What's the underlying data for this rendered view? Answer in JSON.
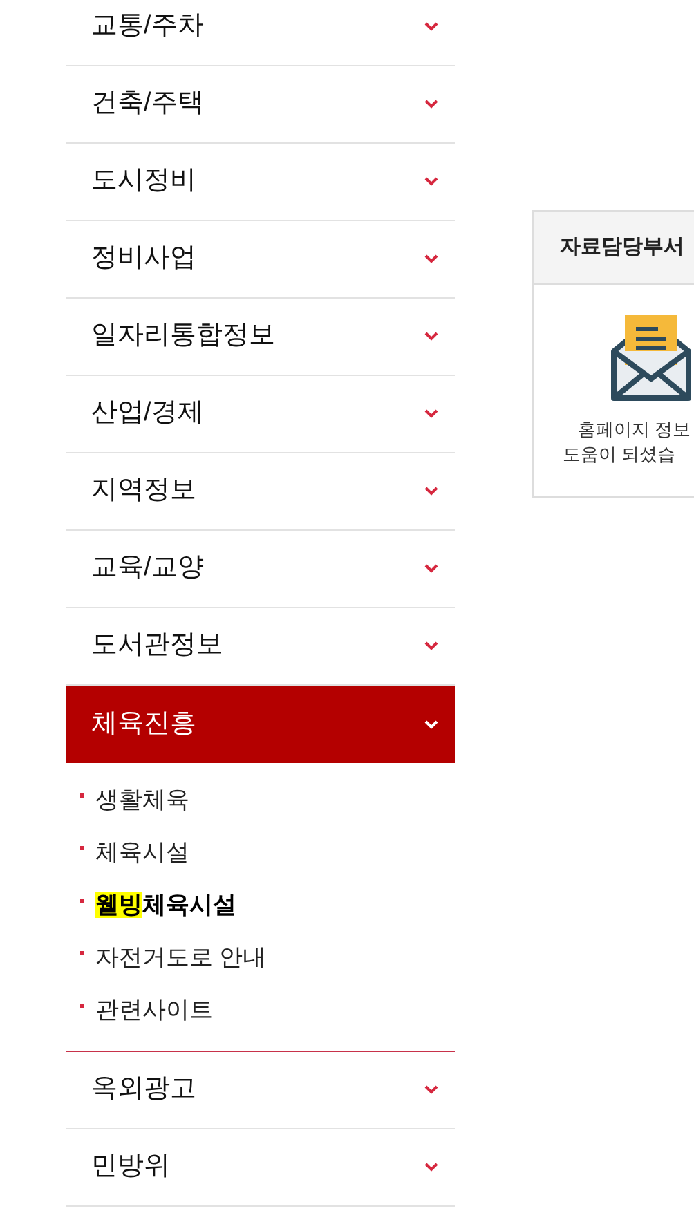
{
  "menu": [
    {
      "label": "교통/주차",
      "expanded": false
    },
    {
      "label": "건축/주택",
      "expanded": false
    },
    {
      "label": "도시정비",
      "expanded": false
    },
    {
      "label": "정비사업",
      "expanded": false
    },
    {
      "label": "일자리통합정보",
      "expanded": false
    },
    {
      "label": "산업/경제",
      "expanded": false
    },
    {
      "label": "지역정보",
      "expanded": false
    },
    {
      "label": "교육/교양",
      "expanded": false
    },
    {
      "label": "도서관정보",
      "expanded": false
    },
    {
      "label": "체육진흥",
      "expanded": true,
      "children": [
        {
          "label": "생활체육",
          "selected": false
        },
        {
          "label": "체육시설",
          "selected": false
        },
        {
          "highlight": "웰빙",
          "label": "체육시설",
          "selected": true
        },
        {
          "label": "자전거도로 안내",
          "selected": false
        },
        {
          "label": "관련사이트",
          "selected": false
        }
      ]
    },
    {
      "label": "옥외광고",
      "expanded": false
    },
    {
      "label": "민방위",
      "expanded": false
    }
  ],
  "feedback": {
    "title": "자료담당부서",
    "lines": [
      "홈페이지 정보",
      "도움이 되셨습"
    ]
  }
}
